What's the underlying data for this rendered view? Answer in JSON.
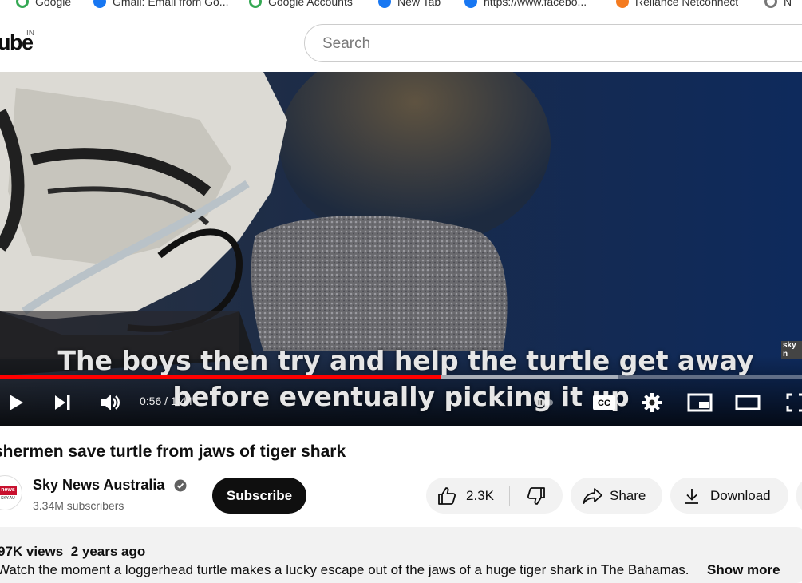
{
  "bookmarks": [
    {
      "label": "Google",
      "icon": "google-icon"
    },
    {
      "label": "Gmail: Email from Go...",
      "icon": "facebook-icon"
    },
    {
      "label": "Google Accounts",
      "icon": "google-icon"
    },
    {
      "label": "New Tab",
      "icon": "facebook-icon"
    },
    {
      "label": "https://www.facebo...",
      "icon": "facebook-icon"
    },
    {
      "label": "Reliance Netconnect",
      "icon": "reliance-icon"
    },
    {
      "label": "N",
      "icon": "globe-icon"
    }
  ],
  "header": {
    "logo_text": "ube",
    "country_code": "IN",
    "search_placeholder": "Search"
  },
  "player": {
    "caption_line1": "The boys then try and help the turtle get away",
    "caption_line2": "before eventually picking it up",
    "watermark": "sky n",
    "time_display": "0:56 / 1:44",
    "progress_fraction": 0.55,
    "buffered_fraction": 0.77
  },
  "video": {
    "title": "shermen save turtle from jaws of tiger shark",
    "channel_name": "Sky News Australia",
    "subscribers": "3.34M subscribers",
    "subscribe_label": "Subscribe",
    "avatar_badge": "news",
    "avatar_sub": "SKY.AU",
    "like_count": "2.3K",
    "share_label": "Share",
    "download_label": "Download",
    "views": "97K views",
    "posted": "2 years ago",
    "description": "Watch the moment a loggerhead turtle makes a lucky escape out of the jaws of a huge tiger shark in The Bahamas.",
    "show_more": "Show more"
  },
  "colors": {
    "progress": "#ff0000",
    "subscribe_bg": "#0f0f0f",
    "pill_bg": "#f2f2f2",
    "verified": "#606060"
  }
}
